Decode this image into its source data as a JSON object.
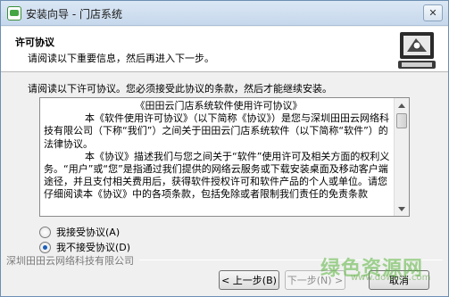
{
  "window": {
    "title": "安装向导 - 门店系统",
    "close_glyph": "✕"
  },
  "header": {
    "title": "许可协议",
    "subtitle": "请阅读以下重要信息，然后再进入下一步。"
  },
  "instruction": "请阅读以下许可协议。您必须接受此协议的条款，然后才能继续安装。",
  "license": {
    "heading": "《田田云门店系统软件使用许可协议》",
    "paragraphs": [
      "本《软件使用许可协议》（以下简称《协议》）是您与深圳田田云网络科技有限公司（下称“我们”）之间关于田田云门店系统软件（以下简称“软件”）的法律协议。",
      "本《协议》描述我们与您之间关于“软件”使用许可及相关方面的权利义务。“用户”或“您”是指通过我们提供的网络云服务或下载安装桌面及移动客户端途径，并且支付相关费用后，获得软件授权许可和软件产品的个人或单位。请您仔细阅读本《协议》中的各项条款，包括免除或者限制我们责任的免责条款"
    ]
  },
  "radios": [
    {
      "label": "我接受协议(A)",
      "checked": false
    },
    {
      "label": "我不接受协议(D)",
      "checked": true
    }
  ],
  "footer": {
    "brand": "深圳田田云网络科技有限公司",
    "back_label": "< 上一步(B)",
    "next_label": "下一步(N) >",
    "cancel_label": "取消"
  },
  "watermark": {
    "text": "绿色资源网",
    "url": "www.downcc.com"
  },
  "colors": {
    "accent": "#1d5fb8",
    "watermark": "#5ab43c"
  }
}
